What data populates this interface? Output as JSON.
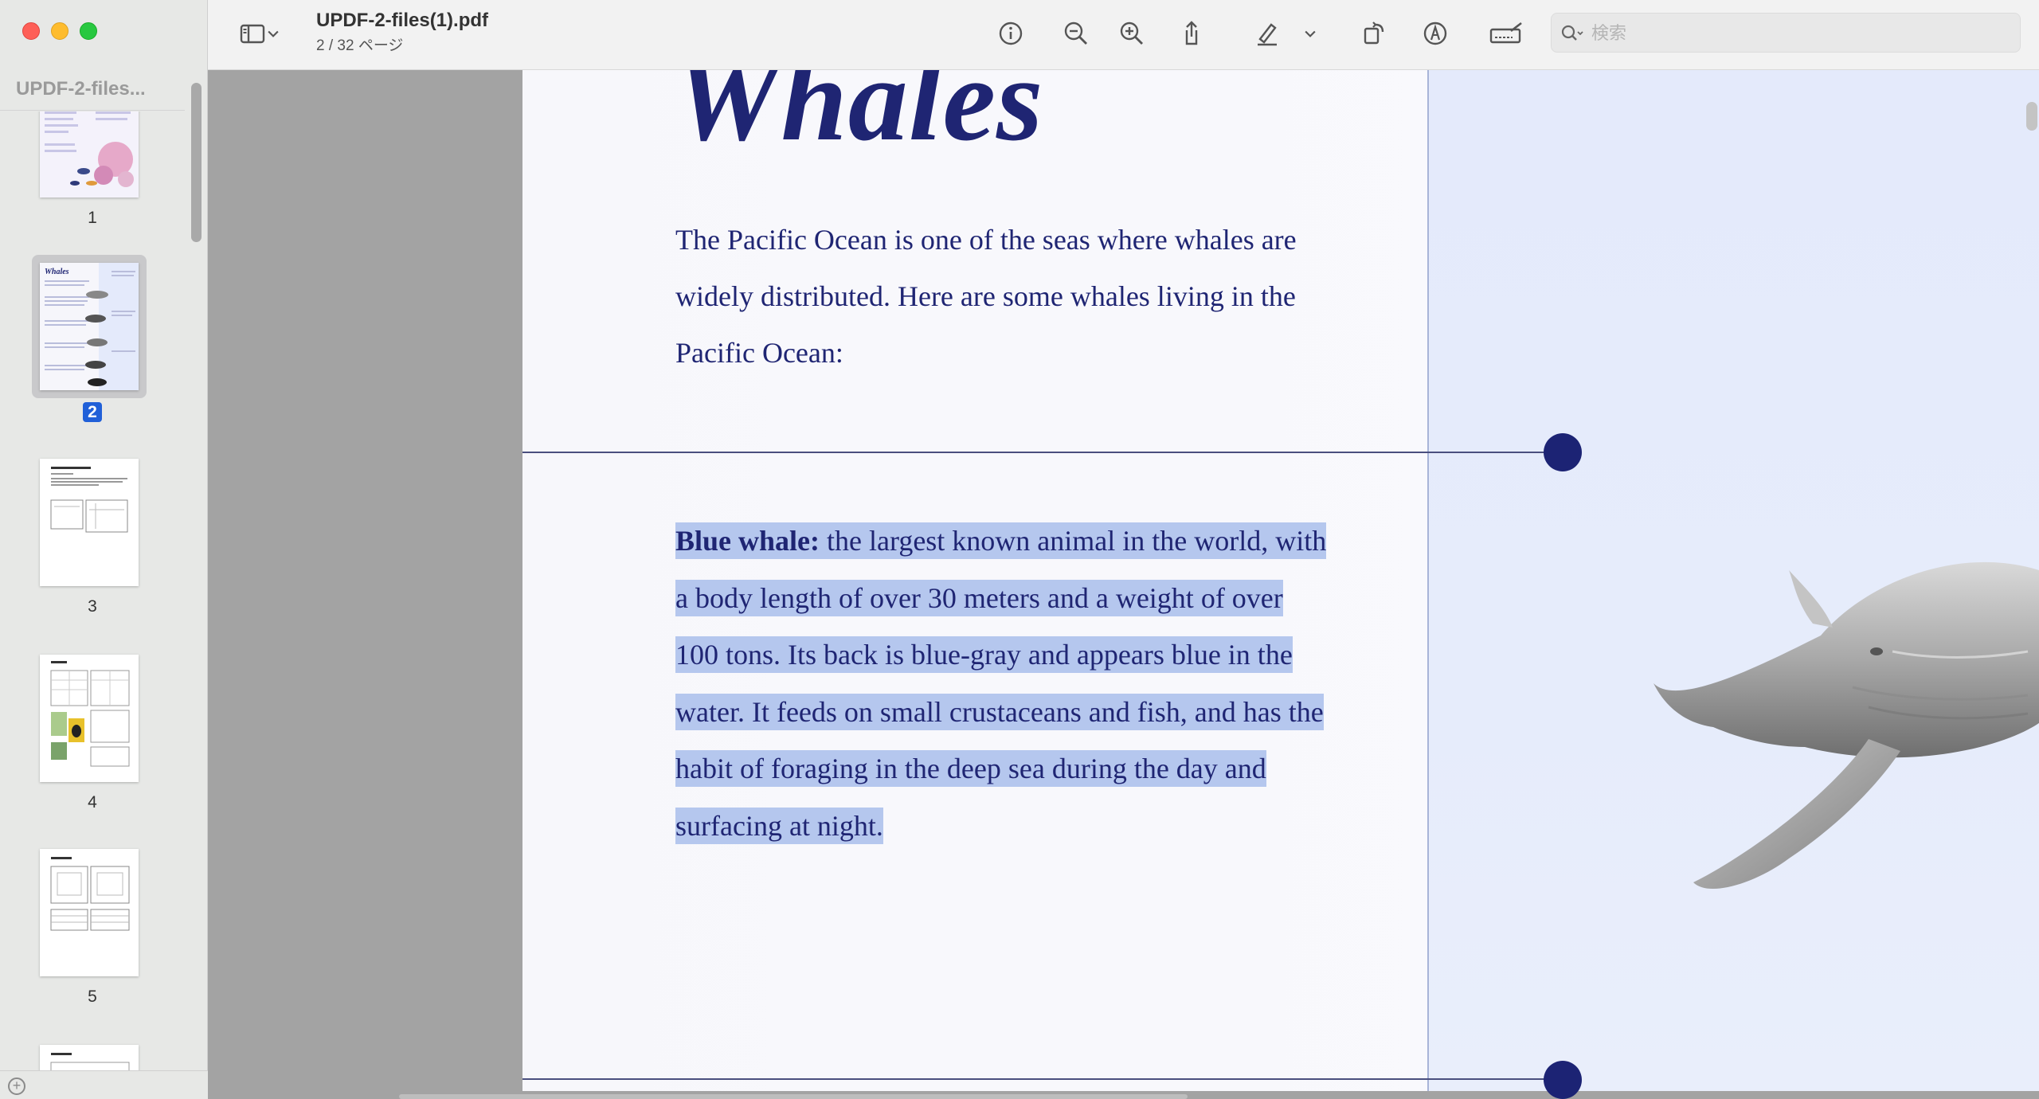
{
  "window": {
    "doc_title": "UPDF-2-files(1).pdf",
    "page_indicator": "2 / 32 ページ"
  },
  "sidebar": {
    "title": "UPDF-2-files...",
    "thumbnails": [
      {
        "label": "1"
      },
      {
        "label": "2",
        "selected": true
      },
      {
        "label": "3"
      },
      {
        "label": "4"
      },
      {
        "label": "5"
      }
    ]
  },
  "toolbar": {
    "icons": [
      "sidebar-toggle-icon",
      "chevron-down-icon",
      "info-icon",
      "zoom-out-icon",
      "zoom-in-icon",
      "share-icon",
      "highlighter-icon",
      "chevron-down-icon",
      "rotate-icon",
      "markup-icon",
      "signature-icon",
      "search-icon"
    ]
  },
  "search": {
    "placeholder": "検索"
  },
  "document": {
    "heading": "Whales",
    "intro": "The Pacific Ocean is one of the seas where whales are widely distributed. Here are some whales living in the Pacific Ocean:",
    "blue_whale_label": "Blue whale:",
    "blue_whale_text": " the largest known animal in the world, with a body length of over 30 meters and a weight of over 100 tons. Its back is blue-gray and appears blue in the water. It feeds on small crustaceans and fish, and has the habit of foraging in the deep sea during the day and surfacing at night."
  },
  "colors": {
    "accent": "#1f2573",
    "highlight": "#b5c7ee",
    "selection": "#2160d8"
  }
}
